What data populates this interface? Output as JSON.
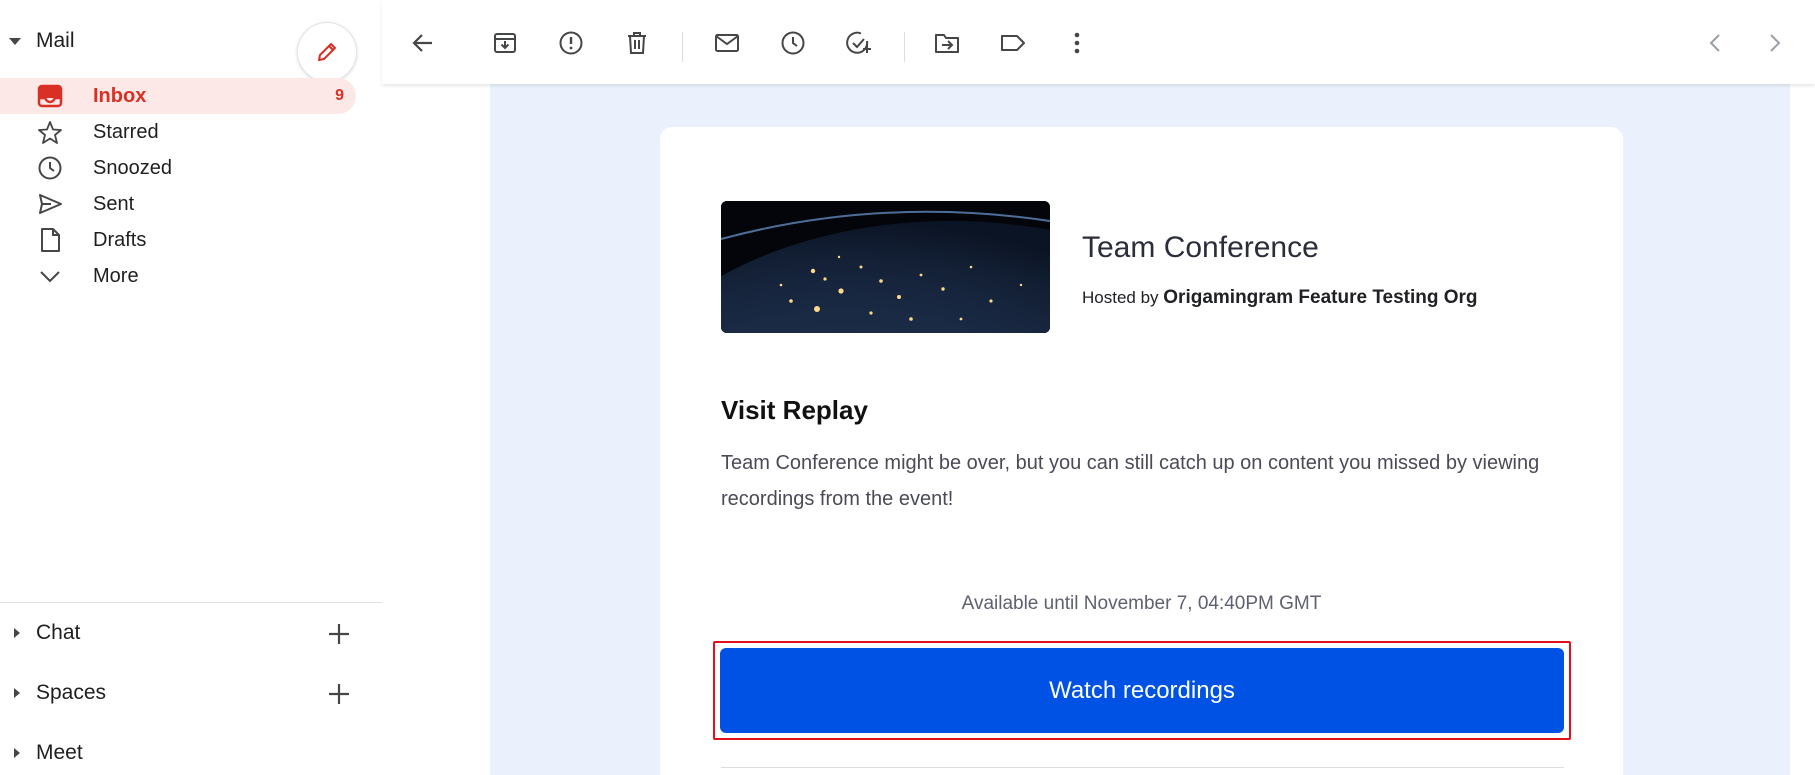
{
  "sidebar": {
    "mail_title": "Mail",
    "compose_icon": "pencil-icon",
    "items": [
      {
        "label": "Inbox",
        "count": "9",
        "icon": "inbox-icon"
      },
      {
        "label": "Starred",
        "count": "",
        "icon": "star-icon"
      },
      {
        "label": "Snoozed",
        "count": "",
        "icon": "clock-icon"
      },
      {
        "label": "Sent",
        "count": "",
        "icon": "send-icon"
      },
      {
        "label": "Drafts",
        "count": "",
        "icon": "draft-icon"
      },
      {
        "label": "More",
        "count": "",
        "icon": "chevron-down-icon"
      }
    ],
    "sections": [
      {
        "label": "Chat",
        "has_add": true
      },
      {
        "label": "Spaces",
        "has_add": true
      },
      {
        "label": "Meet",
        "has_add": false
      }
    ]
  },
  "toolbar": {
    "icons": [
      "back-arrow-icon",
      "archive-icon",
      "report-spam-icon",
      "delete-icon",
      "mark-unread-icon",
      "snooze-icon",
      "add-task-icon",
      "move-to-icon",
      "label-icon",
      "more-vert-icon",
      "newer-chevron-icon",
      "older-chevron-icon"
    ]
  },
  "email": {
    "event_title": "Team Conference",
    "hosted_prefix": "Hosted by",
    "host_org": "Origamingram Feature Testing Org",
    "heading": "Visit Replay",
    "body": "Team Conference might be over, but you can still catch up on content you missed by viewing recordings from the event!",
    "available": "Available until November 7, 04:40PM GMT",
    "cta_label": "Watch recordings"
  },
  "colors": {
    "accent_red": "#d93025",
    "cta_blue": "#0052e5",
    "content_bg": "#eaf1fc",
    "highlight_outline": "#e3101b"
  }
}
